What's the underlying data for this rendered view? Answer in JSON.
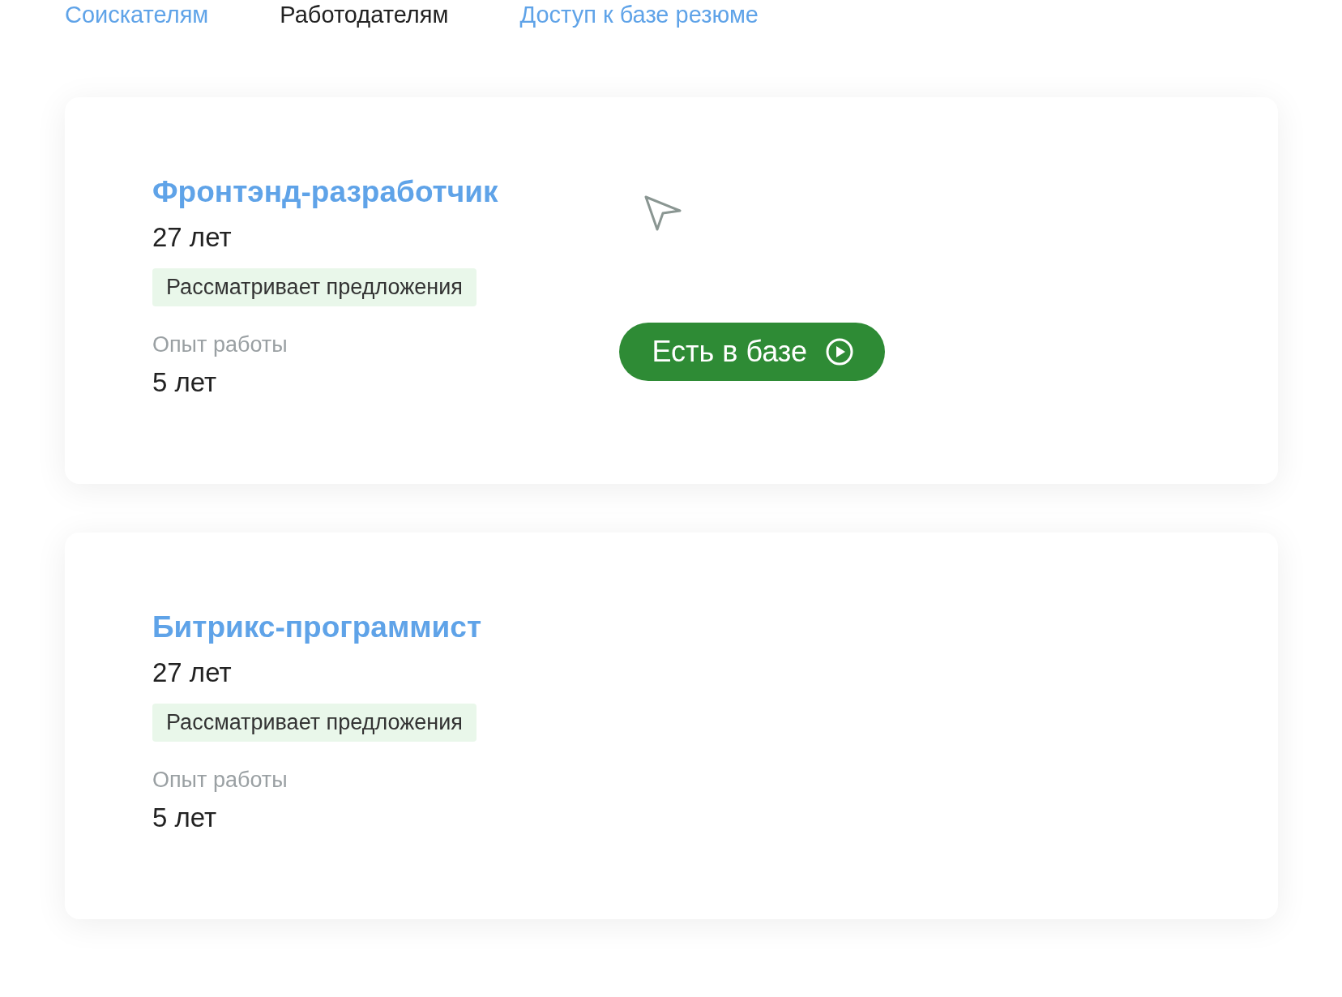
{
  "nav": [
    {
      "label": "Соискателям",
      "selected": false
    },
    {
      "label": "Работодателям",
      "selected": true
    },
    {
      "label": "Доступ к базе резюме",
      "selected": false
    }
  ],
  "cards": [
    {
      "title": "Фронтэнд-разработчик",
      "age": "27 лет",
      "status": "Рассматривает предложения",
      "experience_label": "Опыт работы",
      "experience": "5 лет",
      "action": {
        "label": "Есть в базе"
      }
    },
    {
      "title": "Битрикс-программист",
      "age": "27 лет",
      "status": "Рассматривает предложения",
      "experience_label": "Опыт работы",
      "experience": "5 лет"
    }
  ]
}
